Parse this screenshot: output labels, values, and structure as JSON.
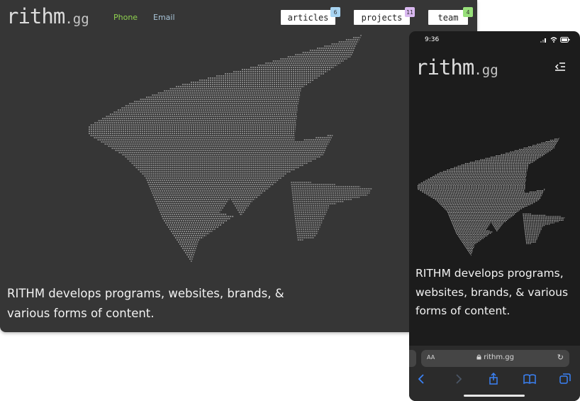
{
  "brand": {
    "name": "rithm",
    "tld": ".gg"
  },
  "contact": {
    "phone": "Phone",
    "email": "Email"
  },
  "nav": [
    {
      "label": "articles",
      "count": "6",
      "badge_color": "#a8d4f2"
    },
    {
      "label": "projects",
      "count": "11",
      "badge_color": "#d9b8f0"
    },
    {
      "label": "team",
      "count": "4",
      "badge_color": "#98e07a"
    }
  ],
  "hero": {
    "tagline": "RITHM develops programs, websites, brands, & various forms of content."
  },
  "mobile": {
    "status_time": "9:36",
    "url": "rithm.gg",
    "aa": "AA",
    "lock_icon": "lock-icon",
    "menu_icon": "menu-icon"
  },
  "colors": {
    "desktop_bg": "#363636",
    "mobile_bg": "#1c1c1c",
    "accent_phone": "#8fd14f",
    "accent_email": "#a8c4d8"
  }
}
